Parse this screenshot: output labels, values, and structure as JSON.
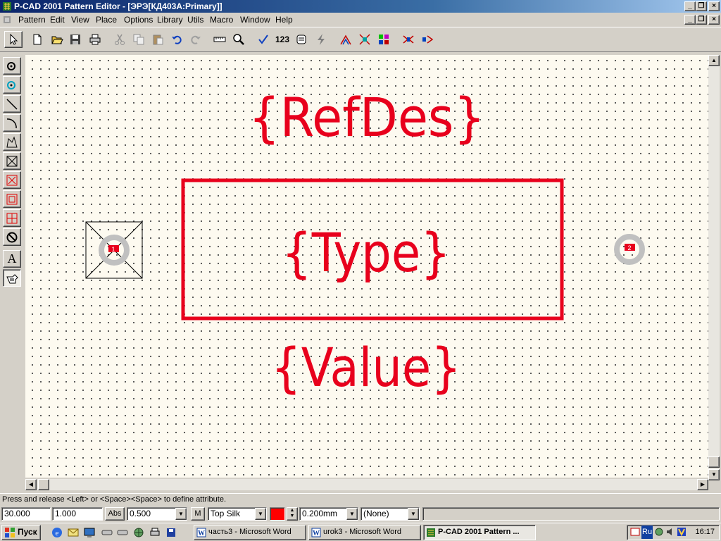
{
  "window": {
    "title": "P-CAD 2001 Pattern Editor - [ЭРЭ[КД403А:Primary]]",
    "caption_buttons": [
      "minimize",
      "restore",
      "close"
    ]
  },
  "menu": [
    "Pattern",
    "Edit",
    "View",
    "Place",
    "Options",
    "Library",
    "Utils",
    "Macro",
    "Window",
    "Help"
  ],
  "toolbar": {
    "buttons": [
      "select",
      "new",
      "open",
      "save",
      "print",
      "cut",
      "copy",
      "paste",
      "undo",
      "redo",
      "measure",
      "zoom",
      "check",
      "renumber",
      "pattern-wizard",
      "drc",
      "layers",
      "pads",
      "vias",
      "attributes",
      "swap"
    ],
    "renumber_label": "123"
  },
  "left_tools": [
    "place-pad",
    "place-via",
    "place-line",
    "place-arc",
    "place-polygon",
    "place-copper-pour",
    "place-cutout",
    "place-keepout",
    "place-point",
    "place-no-connect",
    "place-text",
    "place-attribute"
  ],
  "left_tool_text_label": "A",
  "canvas": {
    "refdes_label": "{RefDes}",
    "type_label": "{Type}",
    "value_label": "{Value}",
    "pad1_number": "1",
    "pad2_number": "2",
    "text_color": "#e8001c",
    "pad_color": "#c0c0c0"
  },
  "status": {
    "message": "Press and release <Left> or <Space><Space> to define attribute."
  },
  "controls": {
    "x": "30.000",
    "y": "1.000",
    "abs_label": "Abs",
    "grid": "0.500",
    "m_label": "M",
    "layer": "Top Silk",
    "layer_color": "#ff0000",
    "line_width": "0.200mm",
    "net": "(None)"
  },
  "taskbar": {
    "start_label": "Пуск",
    "tasks": [
      {
        "label": "часть3 - Microsoft Word",
        "active": false
      },
      {
        "label": "urok3 - Microsoft Word",
        "active": false
      },
      {
        "label": "P-CAD 2001 Pattern ...",
        "active": true
      }
    ],
    "lang": "Ru",
    "clock": "16:17"
  }
}
